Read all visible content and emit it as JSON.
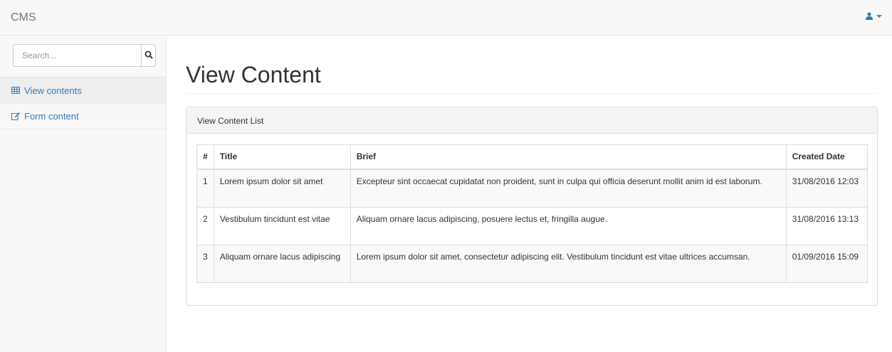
{
  "navbar": {
    "brand": "CMS",
    "user_icon": "user-icon",
    "user_caret": "caret-down-icon"
  },
  "sidebar": {
    "search": {
      "placeholder": "Search...",
      "value": "",
      "button_icon": "search-icon"
    },
    "items": [
      {
        "label": "View contents",
        "icon": "table-icon",
        "active": true
      },
      {
        "label": "Form content",
        "icon": "edit-icon",
        "active": false
      }
    ]
  },
  "main": {
    "page_title": "View Content",
    "panel": {
      "heading": "View Content List",
      "table": {
        "headers": [
          "#",
          "Title",
          "Brief",
          "Created Date"
        ],
        "rows": [
          [
            "1",
            "Lorem ipsum dolor sit amet",
            "Excepteur sint occaecat cupidatat non proident, sunt in culpa qui officia deserunt mollit anim id est laborum.",
            "31/08/2016 12:03"
          ],
          [
            "2",
            "Vestibulum tincidunt est vitae",
            "Aliquam ornare lacus adipiscing, posuere lectus et, fringilla augue.",
            "31/08/2016 13:13"
          ],
          [
            "3",
            "Aliquam ornare lacus adipiscing",
            "Lorem ipsum dolor sit amet, consectetur adipiscing elit. Vestibulum tincidunt est vitae ultrices accumsan.",
            "01/09/2016 15:09"
          ]
        ]
      }
    }
  },
  "colors": {
    "link": "#337ab7",
    "navbar_bg": "#f8f8f8",
    "border": "#dddddd"
  }
}
